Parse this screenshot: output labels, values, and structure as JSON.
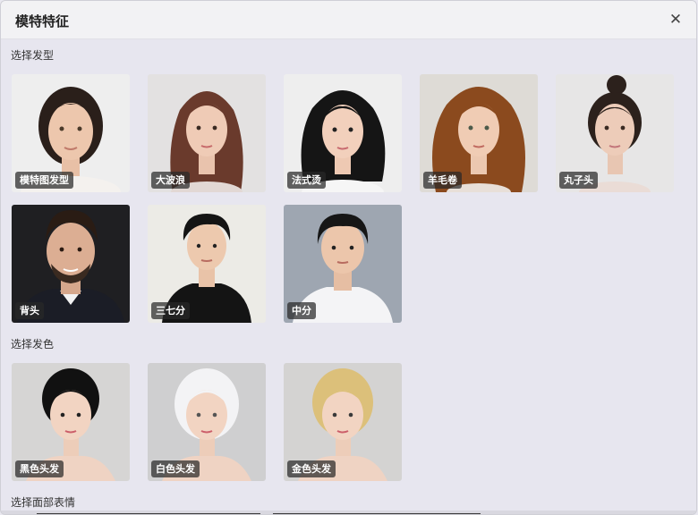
{
  "dialog": {
    "title": "模特特征",
    "close_icon": "close-icon"
  },
  "sections": {
    "hairstyle": {
      "label": "选择发型",
      "items": [
        "模特图发型",
        "大波浪",
        "法式烫",
        "羊毛卷",
        "丸子头",
        "背头",
        "三七分",
        "中分"
      ]
    },
    "haircolor": {
      "label": "选择发色",
      "items": [
        "黑色头发",
        "白色头发",
        "金色头发"
      ]
    },
    "expression": {
      "label": "选择面部表情"
    }
  },
  "colors": {
    "panel_bg": "#e7e6ef",
    "titlebar_bg": "#f2f2f4",
    "tag_bg": "#3a3a3a"
  }
}
